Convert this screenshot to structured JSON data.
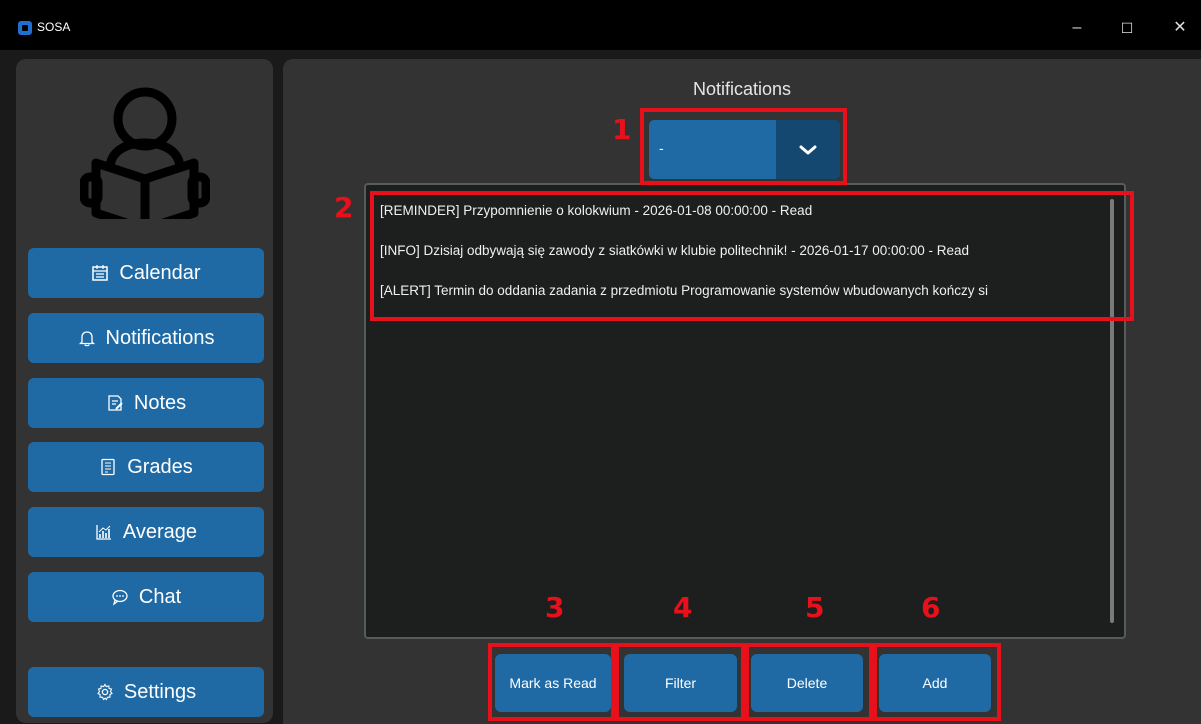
{
  "window": {
    "title": "SOSA",
    "minimize": "–",
    "maximize": "☐",
    "close": "✕"
  },
  "sidebar": {
    "logo": "reader-logo",
    "items": [
      {
        "label": "Calendar",
        "icon": "calendar-icon"
      },
      {
        "label": "Notifications",
        "icon": "bell-icon"
      },
      {
        "label": "Notes",
        "icon": "note-icon"
      },
      {
        "label": "Grades",
        "icon": "document-icon"
      },
      {
        "label": "Average",
        "icon": "chart-icon"
      },
      {
        "label": "Chat",
        "icon": "chat-icon"
      }
    ],
    "settings": {
      "label": "Settings",
      "icon": "gear-icon"
    }
  },
  "main": {
    "title": "Notifications",
    "dropdown": {
      "selected": "-"
    },
    "notifications": [
      "[REMINDER] Przypomnienie o kolokwium - 2026-01-08 00:00:00 - Read",
      "[INFO] Dzisiaj odbywają się zawody z siatkówki w klubie politechnik!  - 2026-01-17 00:00:00 - Read",
      "[ALERT] Termin do oddania zadania z przedmiotu Programowanie systemów wbudowanych kończy si"
    ],
    "actions": {
      "mark_read": "Mark as Read",
      "filter": "Filter",
      "delete": "Delete",
      "add": "Add"
    }
  },
  "annotations": [
    "1",
    "2",
    "3",
    "4",
    "5",
    "6"
  ],
  "colors": {
    "accent": "#1f6aa5",
    "accent_dark": "#144870",
    "annotation": "#e8101b",
    "panel": "#333333"
  }
}
